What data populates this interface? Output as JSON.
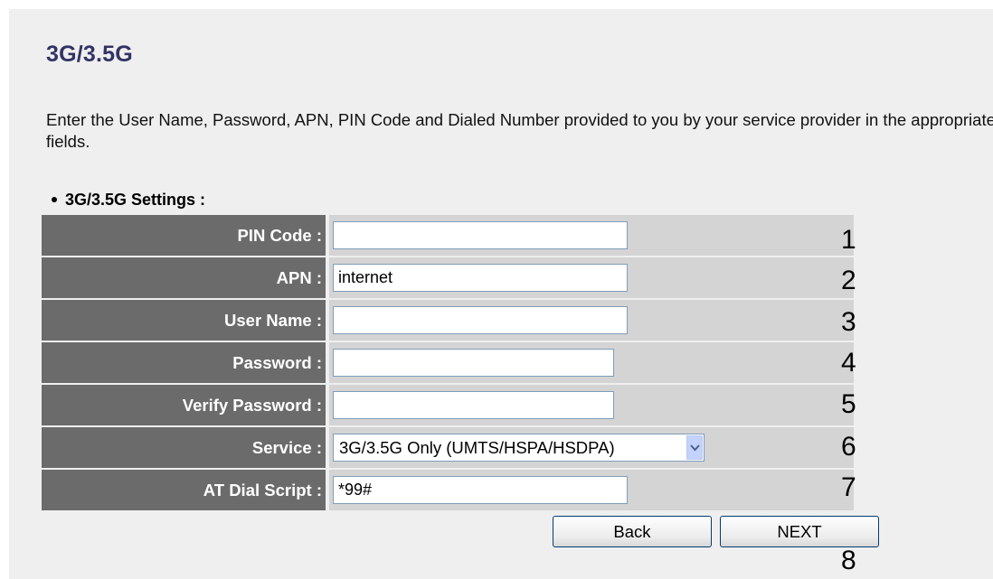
{
  "page": {
    "title": "3G/3.5G",
    "description": "Enter the User Name, Password, APN, PIN Code and Dialed Number provided to you by your service provider in the appropriate fields.",
    "section_title": "3G/3.5G Settings :"
  },
  "form": {
    "pin_code": {
      "label": "PIN Code :",
      "value": "",
      "marker": "1"
    },
    "apn": {
      "label": "APN :",
      "value": "internet",
      "marker": "2"
    },
    "user_name": {
      "label": "User Name :",
      "value": "",
      "marker": "3"
    },
    "password": {
      "label": "Password :",
      "value": "",
      "marker": "4"
    },
    "verify_password": {
      "label": "Verify Password :",
      "value": "",
      "marker": "5"
    },
    "service": {
      "label": "Service :",
      "selected": "3G/3.5G Only (UMTS/HSPA/HSDPA)",
      "marker": "6"
    },
    "at_dial_script": {
      "label": "AT Dial Script :",
      "value": "*99#",
      "marker": "7"
    }
  },
  "buttons": {
    "back": "Back",
    "next": "NEXT",
    "marker": "8"
  },
  "colors": {
    "title": "#333366",
    "label_bg": "#6b6b6b",
    "value_bg": "#d4d4d4",
    "panel_bg": "#efefef",
    "select_arrow": "#c3d3fd"
  }
}
